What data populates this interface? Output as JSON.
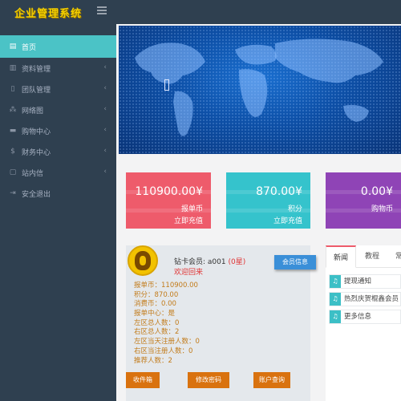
{
  "header": {
    "logo": "企业管理系统",
    "menu_icon": "hamburger-icon"
  },
  "sidebar": {
    "items": [
      {
        "label": "首页",
        "icon": "home-icon",
        "active": true
      },
      {
        "label": "资料管理",
        "icon": "document-icon"
      },
      {
        "label": "团队管理",
        "icon": "team-icon"
      },
      {
        "label": "网络图",
        "icon": "sitemap-icon"
      },
      {
        "label": "购物中心",
        "icon": "truck-icon"
      },
      {
        "label": "财务中心",
        "icon": "dollar-icon"
      },
      {
        "label": "站内信",
        "icon": "message-icon"
      },
      {
        "label": "安全退出",
        "icon": "logout-icon"
      }
    ]
  },
  "cards": [
    {
      "amount": "110900.00¥",
      "label": "报单币",
      "action": "立即充值",
      "color": "#ee5b6b"
    },
    {
      "amount": "870.00¥",
      "label": "积分",
      "action": "立即充值",
      "color": "#35c3cc"
    },
    {
      "amount": "0.00¥",
      "label": "购物币",
      "color": "#8f44b6"
    }
  ],
  "member": {
    "title_prefix": "钻卡会员:  a001",
    "level": "(0星)",
    "welcome": "欢迎回来",
    "info_button": "会员信息",
    "lines": [
      "报单币：110900.00",
      "积分：870.00",
      "消费币：0.00",
      "报单中心：是",
      "左区总人数：0",
      "右区总人数：2",
      "左区当天注册人数：0",
      "右区当注册人数：0",
      "推荐人数：2"
    ],
    "buttons": [
      "收件箱",
      "修改密码",
      "账户查询"
    ]
  },
  "news": {
    "tabs": [
      "新闻",
      "教程",
      "常"
    ],
    "items": [
      "提现通知",
      "热烈庆贺棍鑫会员",
      "更多信息"
    ]
  }
}
